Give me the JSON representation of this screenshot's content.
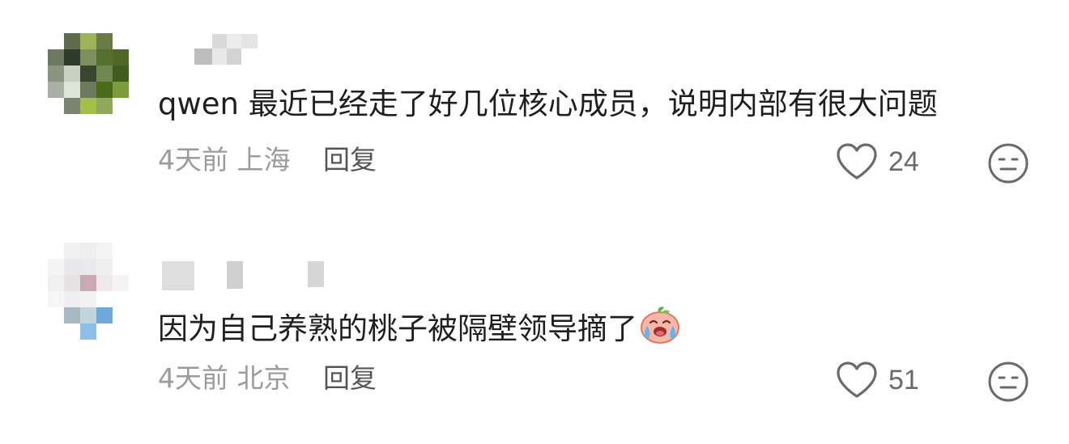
{
  "comments": [
    {
      "text": "qwen 最近已经走了好几位核心成员，说明内部有很大问题",
      "time": "4天前",
      "location": "上海",
      "reply_label": "回复",
      "likes": "24",
      "has_emoji": false
    },
    {
      "text": "因为自己养熟的桃子被隔壁领导摘了",
      "time": "4天前",
      "location": "北京",
      "reply_label": "回复",
      "likes": "51",
      "has_emoji": true,
      "emoji_icon": "crying-peach-emoji-icon"
    }
  ],
  "icons": {
    "like": "heart-outline-icon",
    "dislike": "neutral-face-icon"
  },
  "colors": {
    "text": "#1f1f1f",
    "meta": "#9b9b9b",
    "reply": "#555555",
    "icon": "#6a6a6a"
  }
}
